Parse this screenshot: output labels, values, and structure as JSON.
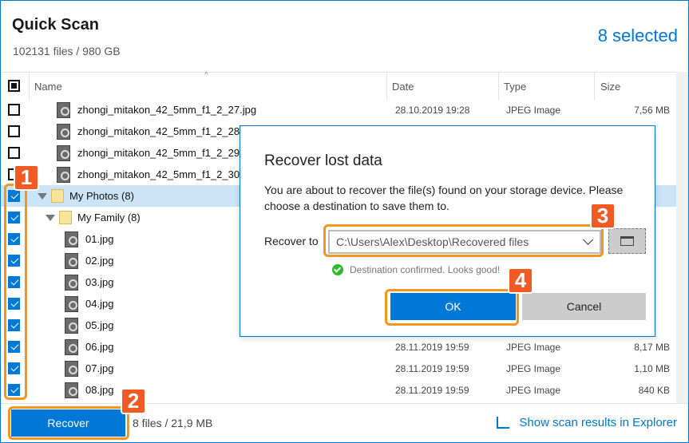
{
  "header": {
    "title": "Quick Scan",
    "subtitle": "102131 files / 980 GB",
    "selected": "8 selected"
  },
  "columns": {
    "name": "Name",
    "date": "Date",
    "type": "Type",
    "size": "Size"
  },
  "rows": [
    {
      "kind": "file",
      "name": "zhongi_mitakon_42_5mm_f1_2_27.jpg",
      "date": "28.10.2019 19:28",
      "type": "JPEG Image",
      "size": "7,56 MB",
      "checked": false
    },
    {
      "kind": "file",
      "name": "zhongi_mitakon_42_5mm_f1_2_28.jpg",
      "checked": false
    },
    {
      "kind": "file",
      "name": "zhongi_mitakon_42_5mm_f1_2_29.jpg",
      "checked": false
    },
    {
      "kind": "file",
      "name": "zhongi_mitakon_42_5mm_f1_2_30.jpg",
      "checked": false
    },
    {
      "kind": "folder",
      "name": "My Photos (8)",
      "checked": true
    },
    {
      "kind": "folder",
      "name": "My Family (8)",
      "checked": true
    },
    {
      "kind": "file",
      "name": "01.jpg",
      "checked": true
    },
    {
      "kind": "file",
      "name": "02.jpg",
      "checked": true
    },
    {
      "kind": "file",
      "name": "03.jpg",
      "checked": true
    },
    {
      "kind": "file",
      "name": "04.jpg",
      "checked": true
    },
    {
      "kind": "file",
      "name": "05.jpg",
      "checked": true
    },
    {
      "kind": "file",
      "name": "06.jpg",
      "date": "28.11.2019 19:59",
      "type": "JPEG Image",
      "size": "8,17 MB",
      "checked": true
    },
    {
      "kind": "file",
      "name": "07.jpg",
      "date": "28.11.2019 19:59",
      "type": "JPEG Image",
      "size": "1,10 MB",
      "checked": true
    },
    {
      "kind": "file",
      "name": "08.jpg",
      "date": "28.11.2019 19:59",
      "type": "JPEG Image",
      "size": "840 KB",
      "checked": true
    }
  ],
  "footer": {
    "recover": "Recover",
    "info": "8 files / 21,9 MB",
    "explorer": "Show scan results in Explorer"
  },
  "dialog": {
    "title": "Recover lost data",
    "text": "You are about to recover the file(s) found on your storage device. Please choose a destination to save them to.",
    "recover_to": "Recover to",
    "path": "C:\\Users\\Alex\\Desktop\\Recovered files",
    "confirm": "Destination confirmed. Looks good!",
    "ok": "OK",
    "cancel": "Cancel"
  },
  "badges": [
    "1",
    "2",
    "3",
    "4"
  ],
  "colors": {
    "accent": "#0078d7",
    "badge": "#f15a22",
    "highlight": "#f7941d"
  }
}
